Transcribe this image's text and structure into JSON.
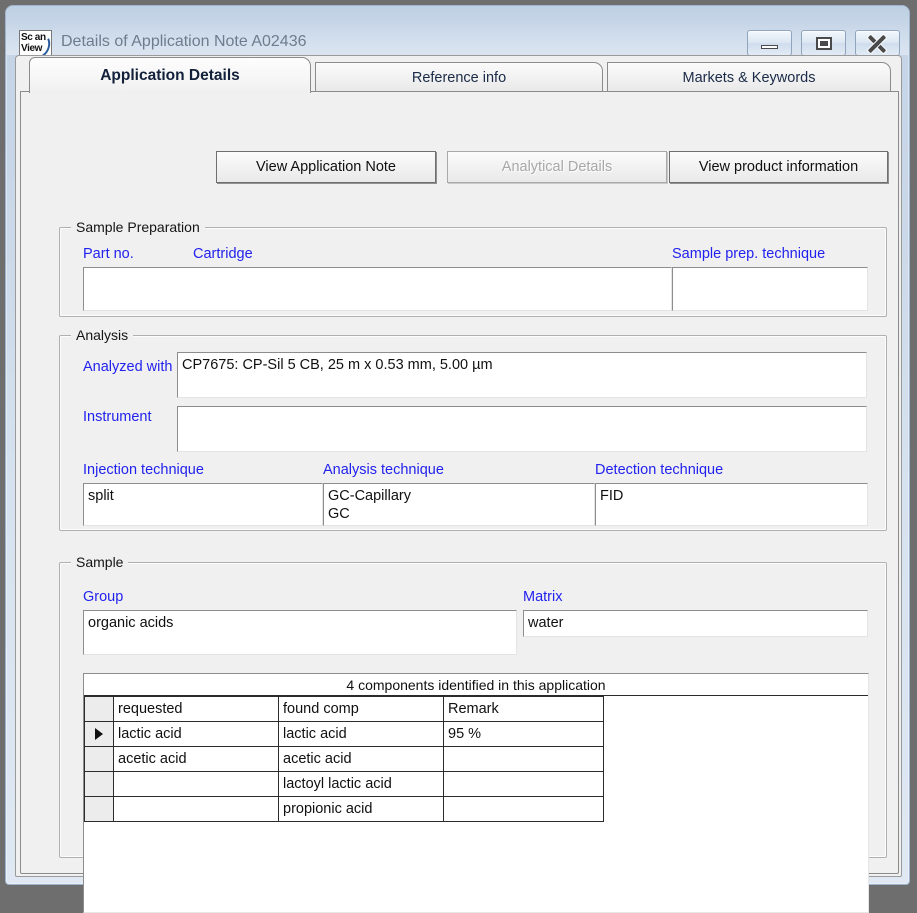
{
  "window": {
    "title": "Details of Application Note A02436",
    "icon_name": "scanview-logo",
    "icon_line1": "Sc an",
    "icon_line2": "View",
    "controls": {
      "minimize": "Minimize",
      "maximize": "Restore",
      "close": "Close"
    }
  },
  "tabs": [
    {
      "label": "Application Details",
      "active": true
    },
    {
      "label": "Reference info",
      "active": false
    },
    {
      "label": "Markets & Keywords",
      "active": false
    }
  ],
  "toolbar": {
    "view_note": "View Application Note",
    "analytical_details": "Analytical Details",
    "analytical_details_disabled": true,
    "view_product": "View product information"
  },
  "sample_preparation": {
    "group_title": "Sample Preparation",
    "part_no_label": "Part no.",
    "cartridge_label": "Cartridge",
    "prep_technique_label": "Sample prep. technique",
    "part_no_value": "",
    "prep_technique_value": ""
  },
  "analysis": {
    "group_title": "Analysis",
    "analyzed_with_label": "Analyzed with",
    "analyzed_with_value": "CP7675: CP-Sil 5 CB, 25 m x 0.53 mm, 5.00 µm",
    "instrument_label": "Instrument",
    "instrument_value": "",
    "injection_label": "Injection technique",
    "injection_value": "split",
    "analysis_label": "Analysis technique",
    "analysis_value": "GC-Capillary\nGC",
    "detection_label": "Detection technique",
    "detection_value": "FID"
  },
  "sample": {
    "group_title": "Sample",
    "group_label": "Group",
    "group_value": "organic acids",
    "matrix_label": "Matrix",
    "matrix_value": "water"
  },
  "components": {
    "caption": "4 components identified in this application",
    "columns": [
      "requested",
      "found  comp",
      "Remark"
    ],
    "rows": [
      {
        "selected": true,
        "requested": "lactic acid",
        "found": "lactic acid",
        "remark": "95 %"
      },
      {
        "selected": false,
        "requested": "acetic acid",
        "found": "acetic acid",
        "remark": ""
      },
      {
        "selected": false,
        "requested": "",
        "found": "lactoyl lactic acid",
        "remark": ""
      },
      {
        "selected": false,
        "requested": "",
        "found": "propionic acid",
        "remark": ""
      }
    ]
  },
  "colors": {
    "label_blue": "#2222ee",
    "tab_active_text": "#12203a",
    "disabled_text": "#a8a8a8",
    "window_chrome": "#cbd9e9"
  }
}
